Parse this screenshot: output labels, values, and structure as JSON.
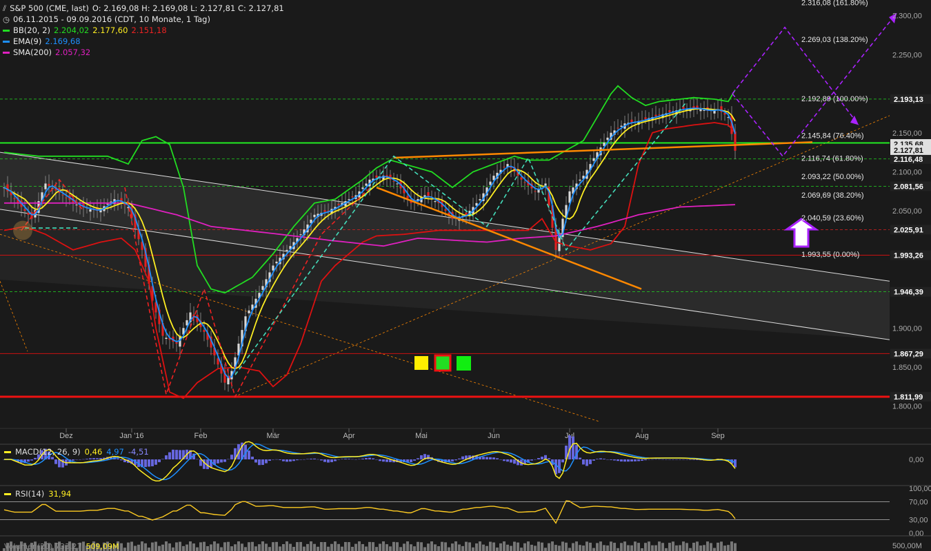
{
  "header": {
    "instrument": "S&P 500 (CME, last)",
    "ohlc": "O: 2.169,08  H: 2.169,08  L: 2.127,81  C: 2.127,81",
    "range": "06.11.2015 - 09.09.2016 (CDT, 10 Monate, 1 Tag)",
    "bb": {
      "label": "BB(20, 2)",
      "v1": "2.204,02",
      "v2": "2.177,60",
      "v3": "2.151,18"
    },
    "ema": {
      "label": "EMA(9)",
      "v": "2.169,68"
    },
    "sma": {
      "label": "SMA(200)",
      "v": "2.057,32"
    }
  },
  "chart_data": {
    "type": "line",
    "y_axis": {
      "min": 1775,
      "max": 2320,
      "ticks": [
        "2.300,00",
        "2.250,00",
        "2.150,00",
        "2.100,00",
        "2.050,00",
        "1.900,00",
        "1.850,00",
        "1.800,00"
      ]
    },
    "x_months": [
      {
        "label": "Dez",
        "i": 18
      },
      {
        "label": "Jan '16",
        "i": 37
      },
      {
        "label": "Feb",
        "i": 57
      },
      {
        "label": "Mär",
        "i": 78
      },
      {
        "label": "Apr",
        "i": 100
      },
      {
        "label": "Mai",
        "i": 121
      },
      {
        "label": "Jun",
        "i": 142
      },
      {
        "label": "Jul",
        "i": 164
      },
      {
        "label": "Aug",
        "i": 185
      },
      {
        "label": "Sep",
        "i": 207
      }
    ],
    "close_anchors": [
      [
        0,
        2080
      ],
      [
        4,
        2060
      ],
      [
        8,
        2040
      ],
      [
        12,
        2085
      ],
      [
        17,
        2070
      ],
      [
        22,
        2055
      ],
      [
        27,
        2050
      ],
      [
        32,
        2065
      ],
      [
        36,
        2055
      ],
      [
        40,
        2000
      ],
      [
        43,
        1935
      ],
      [
        46,
        1890
      ],
      [
        50,
        1880
      ],
      [
        54,
        1920
      ],
      [
        58,
        1895
      ],
      [
        61,
        1865
      ],
      [
        64,
        1830
      ],
      [
        66,
        1845
      ],
      [
        70,
        1915
      ],
      [
        74,
        1945
      ],
      [
        78,
        1980
      ],
      [
        82,
        2000
      ],
      [
        86,
        2020
      ],
      [
        90,
        2045
      ],
      [
        94,
        2050
      ],
      [
        98,
        2060
      ],
      [
        102,
        2070
      ],
      [
        106,
        2090
      ],
      [
        110,
        2095
      ],
      [
        114,
        2085
      ],
      [
        118,
        2060
      ],
      [
        122,
        2070
      ],
      [
        126,
        2060
      ],
      [
        130,
        2040
      ],
      [
        134,
        2045
      ],
      [
        138,
        2065
      ],
      [
        142,
        2095
      ],
      [
        146,
        2110
      ],
      [
        150,
        2090
      ],
      [
        154,
        2075
      ],
      [
        157,
        2085
      ],
      [
        160,
        2000
      ],
      [
        162,
        2040
      ],
      [
        164,
        2075
      ],
      [
        168,
        2095
      ],
      [
        172,
        2125
      ],
      [
        176,
        2150
      ],
      [
        180,
        2162
      ],
      [
        184,
        2165
      ],
      [
        188,
        2170
      ],
      [
        192,
        2175
      ],
      [
        196,
        2180
      ],
      [
        200,
        2182
      ],
      [
        204,
        2178
      ],
      [
        207,
        2180
      ],
      [
        210,
        2170
      ],
      [
        212,
        2127
      ]
    ],
    "sma200_anchors": [
      [
        0,
        2060
      ],
      [
        20,
        2060
      ],
      [
        36,
        2060
      ],
      [
        50,
        2045
      ],
      [
        60,
        2030
      ],
      [
        70,
        2025
      ],
      [
        80,
        2020
      ],
      [
        95,
        2012
      ],
      [
        110,
        2005
      ],
      [
        120,
        2015
      ],
      [
        140,
        2010
      ],
      [
        150,
        2015
      ],
      [
        160,
        2018
      ],
      [
        172,
        2030
      ],
      [
        184,
        2045
      ],
      [
        196,
        2055
      ],
      [
        212,
        2058
      ]
    ],
    "bb_upper_anchors": [
      [
        0,
        2125
      ],
      [
        10,
        2120
      ],
      [
        20,
        2120
      ],
      [
        30,
        2120
      ],
      [
        36,
        2110
      ],
      [
        40,
        2140
      ],
      [
        44,
        2145
      ],
      [
        48,
        2135
      ],
      [
        52,
        2080
      ],
      [
        56,
        1980
      ],
      [
        60,
        1950
      ],
      [
        64,
        1945
      ],
      [
        68,
        1955
      ],
      [
        72,
        1965
      ],
      [
        78,
        1995
      ],
      [
        84,
        2030
      ],
      [
        90,
        2060
      ],
      [
        96,
        2065
      ],
      [
        104,
        2090
      ],
      [
        108,
        2105
      ],
      [
        112,
        2115
      ],
      [
        120,
        2105
      ],
      [
        124,
        2100
      ],
      [
        130,
        2080
      ],
      [
        136,
        2100
      ],
      [
        142,
        2110
      ],
      [
        148,
        2120
      ],
      [
        152,
        2115
      ],
      [
        158,
        2115
      ],
      [
        164,
        2130
      ],
      [
        168,
        2140
      ],
      [
        172,
        2170
      ],
      [
        176,
        2200
      ],
      [
        178,
        2210
      ],
      [
        182,
        2195
      ],
      [
        186,
        2185
      ],
      [
        190,
        2190
      ],
      [
        194,
        2192
      ],
      [
        200,
        2195
      ],
      [
        206,
        2193
      ],
      [
        210,
        2190
      ],
      [
        212,
        2205
      ]
    ],
    "bb_lower_anchors": [
      [
        0,
        2025
      ],
      [
        6,
        2030
      ],
      [
        12,
        2020
      ],
      [
        20,
        2000
      ],
      [
        28,
        2010
      ],
      [
        34,
        2015
      ],
      [
        38,
        2000
      ],
      [
        42,
        1960
      ],
      [
        44,
        1900
      ],
      [
        48,
        1818
      ],
      [
        52,
        1810
      ],
      [
        56,
        1830
      ],
      [
        62,
        1848
      ],
      [
        68,
        1850
      ],
      [
        74,
        1845
      ],
      [
        78,
        1825
      ],
      [
        82,
        1840
      ],
      [
        86,
        1880
      ],
      [
        92,
        1960
      ],
      [
        96,
        1980
      ],
      [
        100,
        1995
      ],
      [
        104,
        2010
      ],
      [
        108,
        2018
      ],
      [
        116,
        2020
      ],
      [
        126,
        2025
      ],
      [
        136,
        2025
      ],
      [
        146,
        2025
      ],
      [
        152,
        2025
      ],
      [
        156,
        2040
      ],
      [
        160,
        2010
      ],
      [
        164,
        2005
      ],
      [
        170,
        2000
      ],
      [
        176,
        2008
      ],
      [
        180,
        2030
      ],
      [
        184,
        2110
      ],
      [
        188,
        2150
      ],
      [
        192,
        2155
      ],
      [
        200,
        2160
      ],
      [
        206,
        2163
      ],
      [
        210,
        2160
      ],
      [
        212,
        2150
      ]
    ],
    "candle_count": 213,
    "horizontal_lines": [
      {
        "value": 2193.13,
        "label": "2.193,13",
        "style": "dash-green"
      },
      {
        "value": 2116.48,
        "label": "2.116,48",
        "style": "dash-green"
      },
      {
        "value": 2081.56,
        "label": "2.081,56",
        "style": "dash-green"
      },
      {
        "value": 2025.91,
        "label": "2.025,91",
        "style": "dash-red"
      },
      {
        "value": 1993.26,
        "label": "1.993,26",
        "style": "solid-red"
      },
      {
        "value": 1946.39,
        "label": "1.946,39",
        "style": "dash-green"
      },
      {
        "value": 1867.29,
        "label": "1.867,29",
        "style": "solid-red"
      },
      {
        "value": 1811.99,
        "label": "1.811,99",
        "style": "thick-red"
      }
    ],
    "price_tags": [
      {
        "value": 2135.68,
        "label": "2.135,68",
        "bg": "#e0e0e0"
      },
      {
        "value": 2127.81,
        "label": "2.127,81",
        "bg": "#e0e0e0"
      }
    ],
    "fibonacci": [
      {
        "value": 2316.08,
        "label": "2.316,08 (161.80%)"
      },
      {
        "value": 2269.03,
        "label": "2.269,03 (138.20%)"
      },
      {
        "value": 2192.89,
        "label": "2.192,89 (100.00%)"
      },
      {
        "value": 2145.84,
        "label": "2.145,84 (76.40%)"
      },
      {
        "value": 2116.74,
        "label": "2.116,74 (61.80%)"
      },
      {
        "value": 2093.22,
        "label": "2.093,22 (50.00%)"
      },
      {
        "value": 2069.69,
        "label": "2.069,69 (38.20%)"
      },
      {
        "value": 2040.59,
        "label": "2.040,59 (23.60%)"
      },
      {
        "value": 1993.55,
        "label": "1.993,55 (0.00%)"
      }
    ]
  },
  "macd": {
    "label": "MACD(12, 26, 9)",
    "v1": "0,46",
    "v2": "4,97",
    "v3": "-4,51",
    "axis": "0,00"
  },
  "rsi": {
    "label": "RSI(14)",
    "v": "31,94",
    "ticks": [
      "100,00",
      "70,00",
      "30,00",
      "0,00"
    ]
  },
  "volume": {
    "label": "Volumen(20)  733.27",
    "v": "509,09M",
    "axis": "500,00M"
  },
  "colors": {
    "bg": "#1a1a1a",
    "bb": "#22dd22",
    "ema": "#1e90ff",
    "sma": "#e020c0",
    "close_line": "#ffee22",
    "lower_band": "#dd1111",
    "trend": "#ff8800",
    "fib": "#aa22ff"
  }
}
